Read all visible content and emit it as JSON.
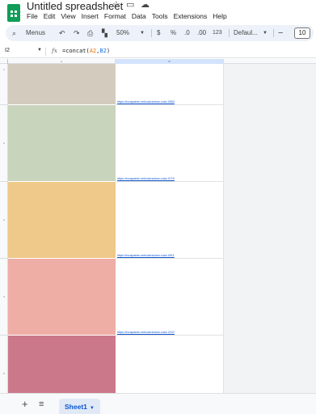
{
  "app": {
    "title": "Untitled spreadsheet",
    "icons": [
      "star-icon",
      "move-to-folder-icon",
      "cloud-status-icon"
    ]
  },
  "menu": [
    "File",
    "Edit",
    "View",
    "Insert",
    "Format",
    "Data",
    "Tools",
    "Extensions",
    "Help"
  ],
  "toolbar": {
    "search_label": "Menus",
    "zoom": "50%",
    "currency": "$",
    "percent": "%",
    "decrease_decimal": ".0",
    "increase_decimal": ".00",
    "number_format": "123",
    "font": "Defaul...",
    "font_size": "10"
  },
  "formula_bar": {
    "name_box": "I2",
    "fx": "fx",
    "formula_prefix": "=concat(",
    "ref1": "A2",
    "comma": ",",
    "ref2": "B2",
    "formula_suffix": ")"
  },
  "grid": {
    "col_headers": [
      "A",
      "B"
    ],
    "row_headers": [
      "1",
      "2",
      "3",
      "4",
      "5"
    ],
    "rows": [
      {
        "color": "#d4cbbf",
        "link": "https://ecospaints.net/colors/view-color-0563"
      },
      {
        "color": "#c9d4bd",
        "link": "https://ecospaints.net/colors/view-color-0719"
      },
      {
        "color": "#efc98a",
        "link": "https://ecospaints.net/colors/view-color-0911"
      },
      {
        "color": "#eeaea6",
        "link": "https://ecospaints.net/colors/view-color-2222"
      },
      {
        "color": "#cb798a",
        "link": ""
      }
    ]
  },
  "sheets": {
    "add_label": "+",
    "all_label": "≡",
    "active": "Sheet1"
  }
}
